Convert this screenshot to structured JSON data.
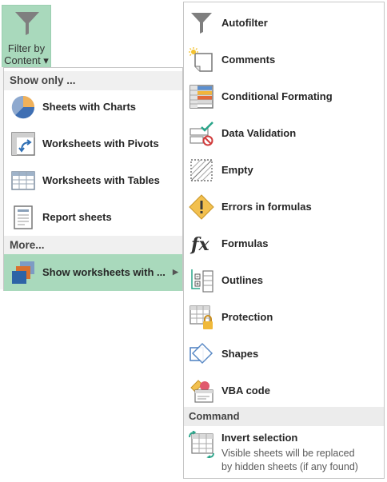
{
  "ribbon": {
    "button_line1": "Filter by",
    "button_line2": "Content ▾"
  },
  "left_menu": {
    "section_show_only": "Show only ...",
    "items": [
      {
        "label": "Sheets with Charts",
        "icon": "pie-chart-icon"
      },
      {
        "label": "Worksheets with Pivots",
        "icon": "pivot-table-icon"
      },
      {
        "label": "Worksheets with Tables",
        "icon": "table-icon"
      },
      {
        "label": "Report sheets",
        "icon": "report-sheet-icon"
      }
    ],
    "section_more": "More...",
    "show_with": {
      "label": "Show worksheets with ...",
      "icon": "worksheets-stack-icon",
      "selected": true
    }
  },
  "right_menu": {
    "items": [
      {
        "label": "Autofilter",
        "icon": "funnel-icon"
      },
      {
        "label": "Comments",
        "icon": "comment-note-icon"
      },
      {
        "label": "Conditional Formating",
        "icon": "conditional-formatting-icon"
      },
      {
        "label": "Data Validation",
        "icon": "data-validation-icon"
      },
      {
        "label": "Empty",
        "icon": "empty-range-icon"
      },
      {
        "label": "Errors in formulas",
        "icon": "warning-icon"
      },
      {
        "label": "Formulas",
        "icon": "fx-icon"
      },
      {
        "label": "Outlines",
        "icon": "outline-icon"
      },
      {
        "label": "Protection",
        "icon": "lock-sheet-icon"
      },
      {
        "label": "Shapes",
        "icon": "shapes-icon"
      },
      {
        "label": "VBA code",
        "icon": "vba-code-icon"
      }
    ],
    "command_header": "Command",
    "invert": {
      "title": "Invert selection",
      "desc_line1": "Visible sheets will be replaced",
      "desc_line2": "by hidden sheets (if any found)",
      "icon": "invert-selection-icon"
    }
  },
  "colors": {
    "accent_green": "#a9d9bc",
    "header_gray": "#f0f0f0",
    "border": "#c6c6c6"
  }
}
